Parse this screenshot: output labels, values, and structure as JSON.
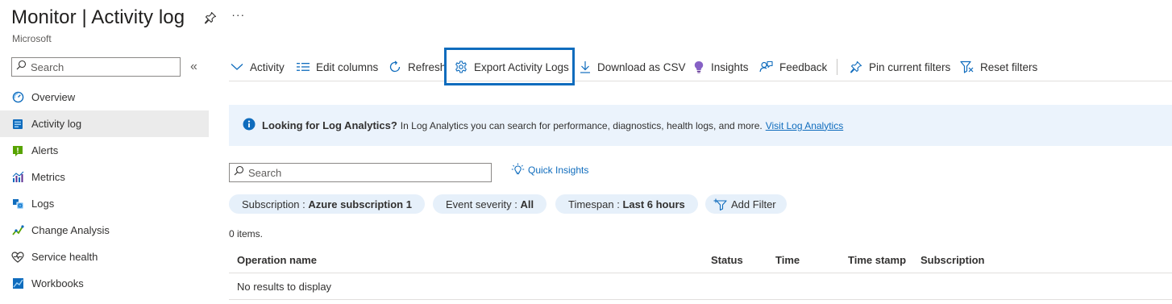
{
  "header": {
    "title": "Monitor | Activity log",
    "subtitle": "Microsoft",
    "more": "···"
  },
  "sidebar": {
    "search_placeholder": "Search",
    "collapse": "«",
    "items": [
      {
        "label": "Overview",
        "icon": "overview-icon"
      },
      {
        "label": "Activity log",
        "icon": "activity-log-icon",
        "active": true
      },
      {
        "label": "Alerts",
        "icon": "alerts-icon"
      },
      {
        "label": "Metrics",
        "icon": "metrics-icon"
      },
      {
        "label": "Logs",
        "icon": "logs-icon"
      },
      {
        "label": "Change Analysis",
        "icon": "change-analysis-icon"
      },
      {
        "label": "Service health",
        "icon": "service-health-icon"
      },
      {
        "label": "Workbooks",
        "icon": "workbooks-icon"
      }
    ]
  },
  "toolbar": {
    "activity": "Activity",
    "edit_columns": "Edit columns",
    "refresh": "Refresh",
    "export": "Export Activity Logs",
    "download": "Download as CSV",
    "insights": "Insights",
    "feedback": "Feedback",
    "pin_filters": "Pin current filters",
    "reset_filters": "Reset filters"
  },
  "banner": {
    "title": "Looking for Log Analytics?",
    "text": "In Log Analytics you can search for performance, diagnostics, health logs, and more.",
    "link": "Visit Log Analytics"
  },
  "main": {
    "search_placeholder": "Search",
    "quick_insights": "Quick Insights",
    "filters": [
      {
        "label": "Subscription : ",
        "value": "Azure subscription 1"
      },
      {
        "label": "Event severity : ",
        "value": "All"
      },
      {
        "label": "Timespan : ",
        "value": "Last 6 hours"
      }
    ],
    "add_filter": "Add Filter",
    "count": "0 items.",
    "columns": [
      "Operation name",
      "Status",
      "Time",
      "Time stamp",
      "Subscription"
    ],
    "empty": "No results to display"
  },
  "colors": {
    "accent": "#0f6cbd",
    "active_bg": "#ebebeb",
    "banner_bg": "#ebf3fc",
    "pill_bg": "#e6f0fa"
  }
}
